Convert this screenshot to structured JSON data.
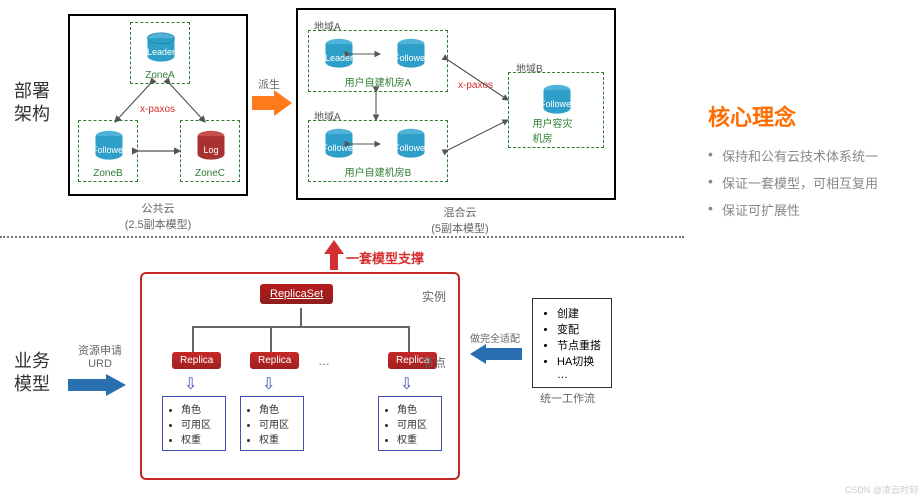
{
  "left_labels": {
    "deploy": "部署\n架构",
    "biz": "业务\n模型"
  },
  "public_cloud": {
    "leader": "Leader",
    "follower": "Follower",
    "log": "Log",
    "zoneA": "ZoneA",
    "zoneB": "ZoneB",
    "zoneC": "ZoneC",
    "caption1": "公共云",
    "caption2": "(2.5副本模型)",
    "xpaxos": "x-paxos"
  },
  "derive": "派生",
  "hybrid": {
    "regionA1": "地域A",
    "regionA2": "地域A",
    "regionB": "地域B",
    "leader": "Leader",
    "follower": "Follower",
    "room_a": "用户自建机房A",
    "room_b": "用户自建机房B",
    "room_dr": "用户容灾机房",
    "xpaxos": "x-paxos",
    "caption1": "混合云",
    "caption2": "(5副本模型)"
  },
  "support_text": "一套模型支撑",
  "biz_model": {
    "req1": "资源申请",
    "req2": "URD",
    "replicaset": "ReplicaSet",
    "replica": "Replica",
    "instance": "实例",
    "node": "节点",
    "attr1": "角色",
    "attr2": "可用区",
    "attr3": "权重",
    "adapt": "做完全适配",
    "wf1": "创建",
    "wf2": "变配",
    "wf3": "节点重搭",
    "wf4": "HA切换",
    "wf5": "…",
    "wf_caption": "统一工作流",
    "dots": "…"
  },
  "right": {
    "title": "核心理念",
    "li1": "保持和公有云技术体系统一",
    "li2": "保证一套模型，可相互复用",
    "li3": "保证可扩展性"
  },
  "watermark": "CSDN @凌云时刻"
}
